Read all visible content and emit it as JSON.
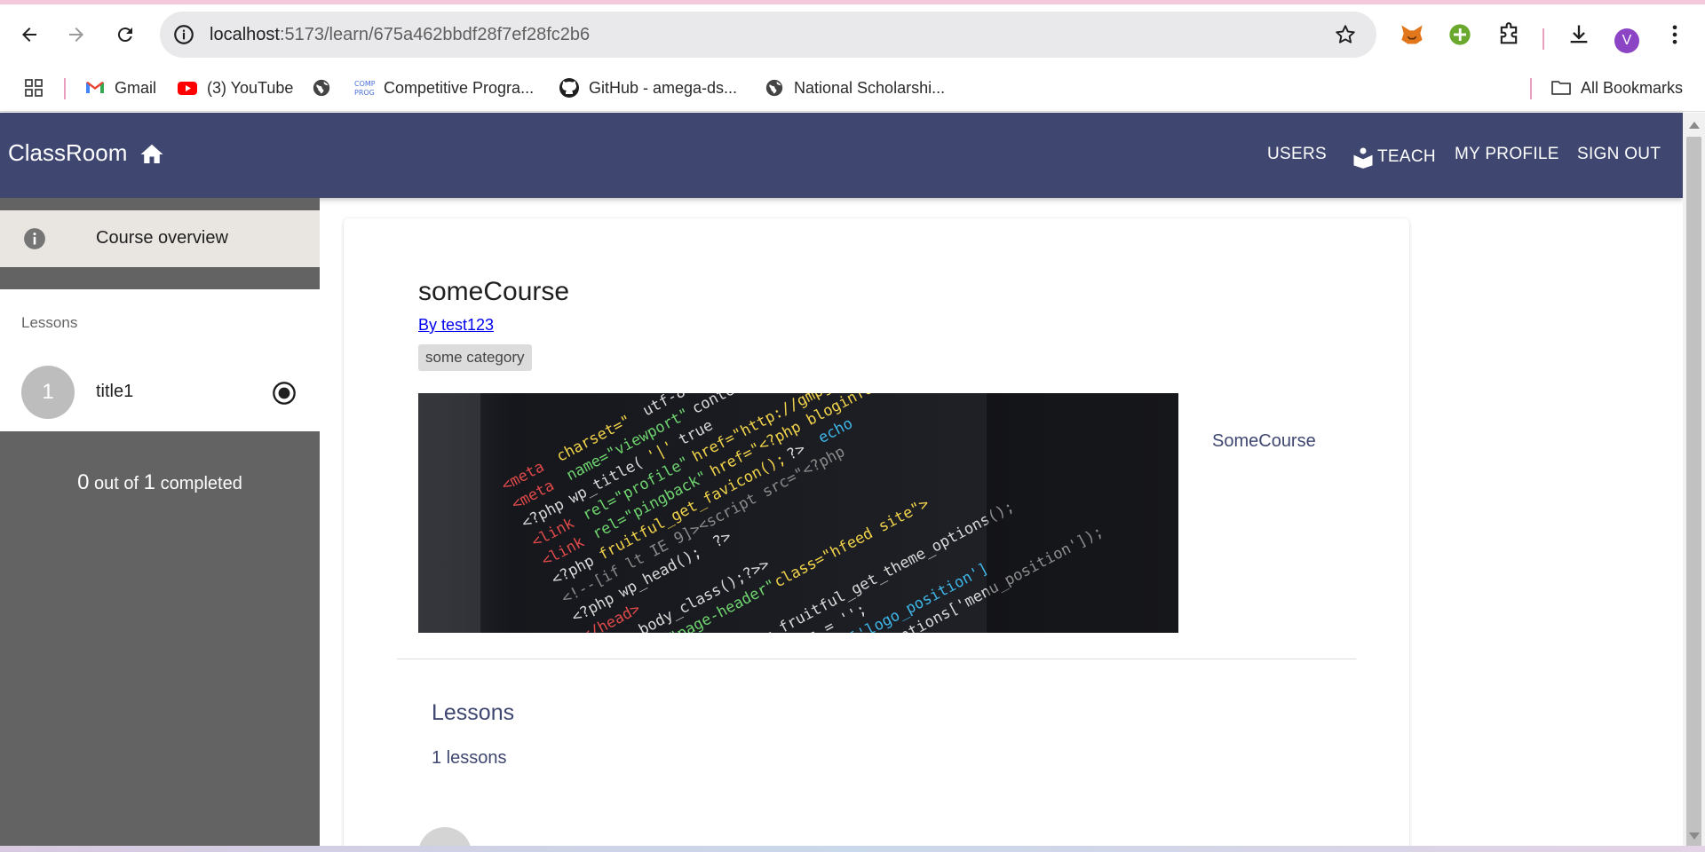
{
  "browser": {
    "url_host": "localhost",
    "url_path": ":5173/learn/675a462bbdf28f7ef28fc2b6",
    "avatar_letter": "V",
    "bookmarks": [
      {
        "label": "Gmail",
        "icon": "gmail-icon"
      },
      {
        "label": "(3) YouTube",
        "icon": "youtube-icon"
      },
      {
        "label": "",
        "icon": "globe-icon"
      },
      {
        "label": "Competitive Progra...",
        "icon": "comp-prog-icon"
      },
      {
        "label": "GitHub - amega-ds...",
        "icon": "github-icon"
      },
      {
        "label": "National Scholarshi...",
        "icon": "globe-icon"
      }
    ],
    "all_bookmarks": "All Bookmarks"
  },
  "app": {
    "brand": "ClassRoom",
    "nav": {
      "users": "USERS",
      "teach": "TEACH",
      "profile": "MY PROFILE",
      "signout": "SIGN OUT"
    },
    "colors": {
      "app_bar": "#3f4771",
      "sidebar": "#636363",
      "accent_text": "#3f4771"
    }
  },
  "sidebar": {
    "overview": "Course overview",
    "lessons_heading": "Lessons",
    "lessons": [
      {
        "number": "1",
        "title": "title1",
        "status": "radio-checked-icon"
      }
    ],
    "progress": {
      "done": "0",
      "mid": "out of",
      "total": "1",
      "suffix": "completed"
    }
  },
  "course": {
    "title": "someCourse",
    "author": "By test123",
    "category": "some category",
    "description": "SomeCourse",
    "lessons_heading": "Lessons",
    "lessons_count": "1 lessons"
  }
}
